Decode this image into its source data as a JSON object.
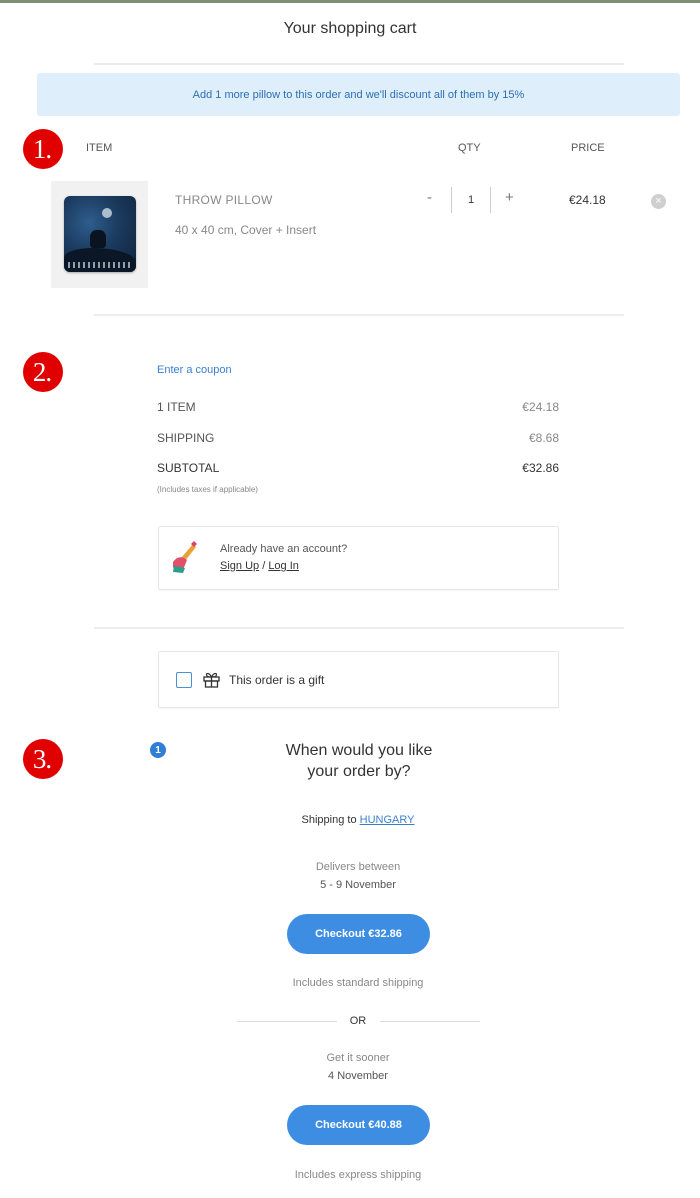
{
  "header": {
    "title": "Your shopping cart"
  },
  "banner": {
    "text": "Add 1 more pillow to this order and we'll discount all of them by 15%"
  },
  "markers": [
    "1.",
    "2.",
    "3."
  ],
  "cart": {
    "columns": {
      "item": "ITEM",
      "qty": "QTY",
      "price": "PRICE"
    },
    "items": [
      {
        "name": "THROW PILLOW",
        "description": "40 x 40 cm, Cover + Insert",
        "qty_minus": "-",
        "quantity": "1",
        "qty_plus": "+",
        "price": "€24.18",
        "remove_icon": "close-circle-icon"
      }
    ]
  },
  "summary": {
    "coupon_link": "Enter a coupon",
    "rows": [
      {
        "label": "1 ITEM",
        "value": "€24.18"
      },
      {
        "label": "SHIPPING",
        "value": "€8.68"
      },
      {
        "label": "SUBTOTAL",
        "value": "€32.86"
      }
    ],
    "tax_note": "(Includes taxes if applicable)"
  },
  "account": {
    "prompt": "Already have an account?",
    "sign_up": "Sign Up",
    "separator": " / ",
    "log_in": "Log In",
    "icon": "pencil-hand-icon"
  },
  "gift": {
    "label": "This order is a gift",
    "icon": "gift-icon",
    "checked": false
  },
  "delivery": {
    "step_number": "1",
    "question_line1": "When would you like",
    "question_line2": "your order by?",
    "shipping_prefix": "Shipping to ",
    "country": "HUNGARY",
    "standard": {
      "line1": "Delivers between",
      "line2": "5 - 9 November",
      "button": "Checkout €32.86",
      "note": "Includes standard shipping"
    },
    "or": "OR",
    "express": {
      "line1": "Get it sooner",
      "line2": "4 November",
      "button": "Checkout €40.88",
      "note": "Includes express shipping"
    }
  },
  "colors": {
    "accent": "#3d8de3",
    "marker": "#e00000",
    "banner_bg": "#deeefb"
  }
}
